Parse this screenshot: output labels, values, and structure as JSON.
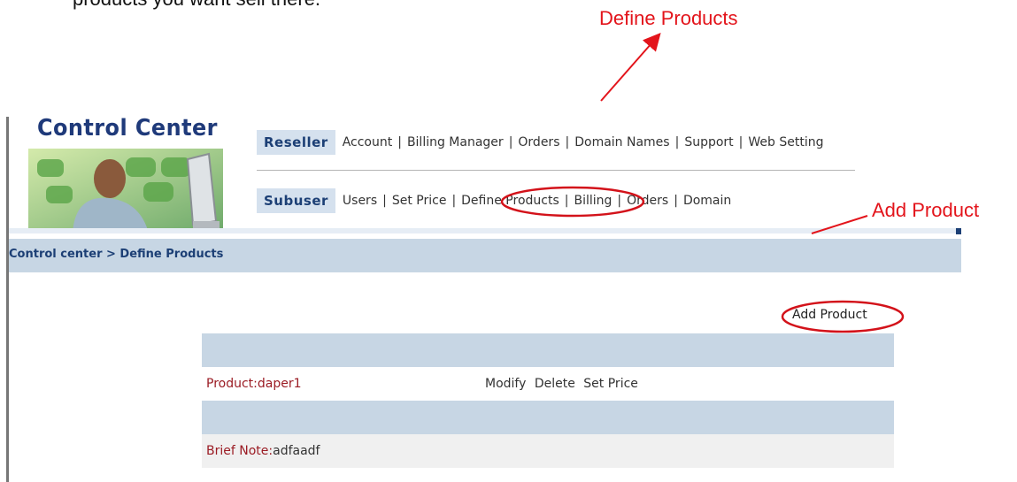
{
  "doc": {
    "cut_text": "products you want sell there."
  },
  "annotations": {
    "define_products": "Define Products",
    "add_product": "Add Product"
  },
  "logo": {
    "title": "Control Center"
  },
  "nav": {
    "reseller": {
      "heading": "Reseller",
      "links": [
        "Account",
        "Billing Manager",
        "Orders",
        "Domain Names",
        "Support",
        "Web Setting"
      ]
    },
    "subuser": {
      "heading": "Subuser",
      "links": [
        "Users",
        "Set Price",
        "Define Products",
        "Billing",
        "Orders",
        "Domain"
      ]
    }
  },
  "breadcrumb": "Control center > Define Products",
  "add_product_link": "Add Product",
  "product": {
    "label": "Product:",
    "name": "daper1",
    "actions": [
      "Modify",
      "Delete",
      "Set Price"
    ]
  },
  "brief_note": {
    "label": "Brief Note:",
    "value": "adfaadf"
  },
  "colors": {
    "annotation": "#e3141b",
    "nav_heading": "#1c3f75",
    "band": "#c7d6e4",
    "label_red": "#9b1c24"
  }
}
